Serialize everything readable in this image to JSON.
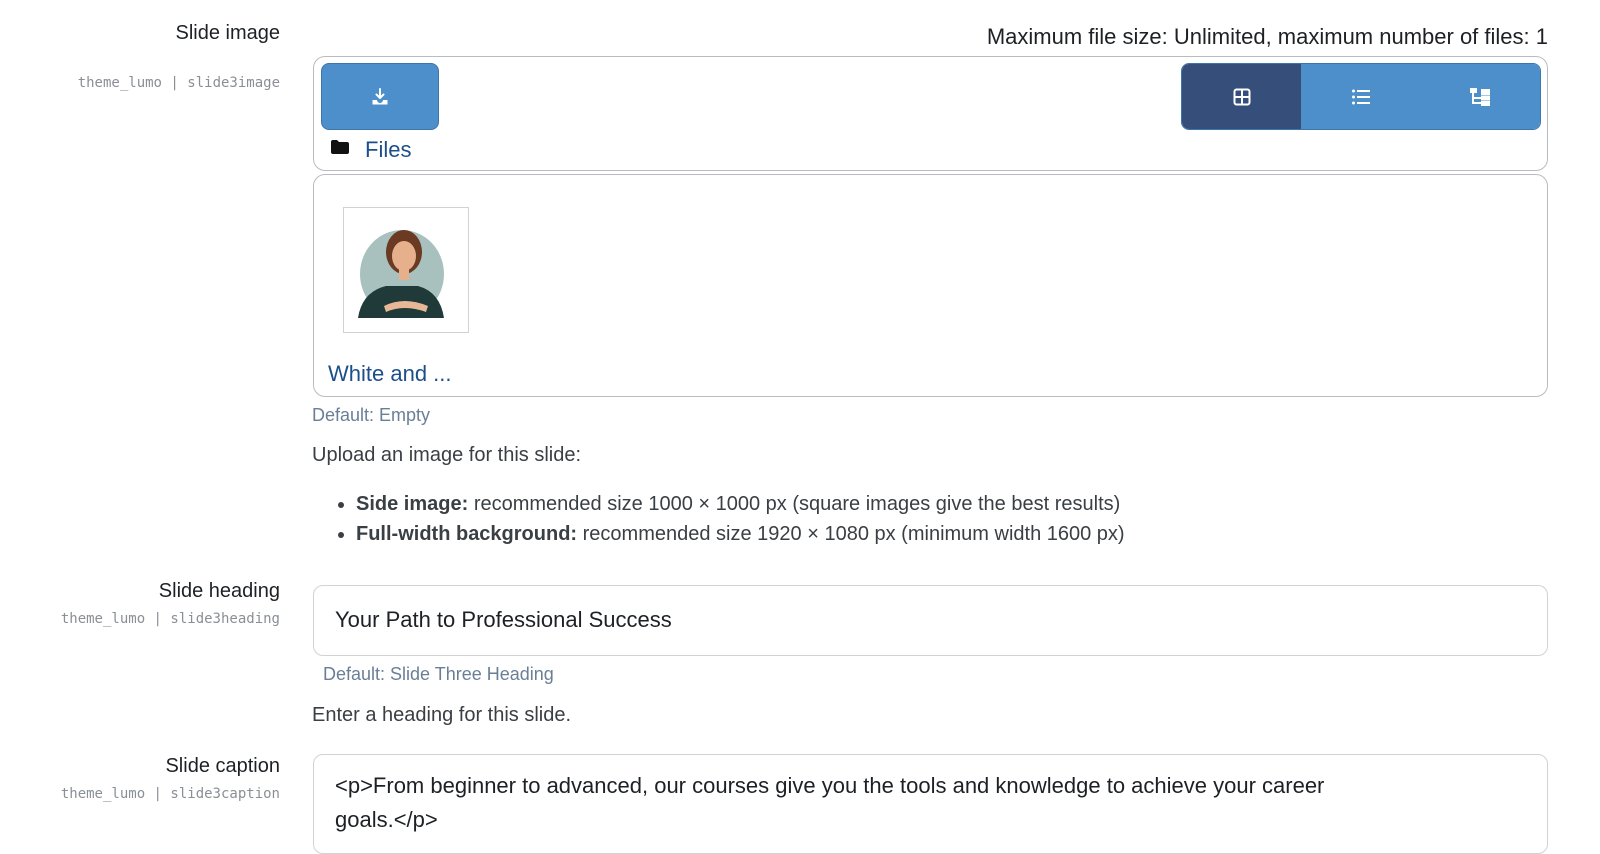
{
  "slide_image": {
    "label": "Slide image",
    "setting": "theme_lumo | slide3image",
    "max_info": "Maximum file size: Unlimited, maximum number of files: 1",
    "upload_icon": "download-tray-icon",
    "view_buttons": [
      {
        "icon": "grid-view-icon",
        "active": true
      },
      {
        "icon": "list-view-icon",
        "active": false
      },
      {
        "icon": "tree-view-icon",
        "active": false
      }
    ],
    "folder_icon": "folder-icon",
    "folder_label": "Files",
    "file": {
      "name": "White and ..."
    },
    "default": "Default: Empty",
    "description": "Upload an image for this slide:",
    "bullets": [
      {
        "strong": "Side image:",
        "text": " recommended size 1000 × 1000 px (square images give the best results)"
      },
      {
        "strong": "Full-width background:",
        "text": " recommended size 1920 × 1080 px (minimum width 1600 px)"
      }
    ]
  },
  "slide_heading": {
    "label": "Slide heading",
    "setting": "theme_lumo | slide3heading",
    "value": "Your Path to Professional Success",
    "default": "Default: Slide Three Heading",
    "description": "Enter a heading for this slide."
  },
  "slide_caption": {
    "label": "Slide caption",
    "setting": "theme_lumo | slide3caption",
    "value_line1": "<p>From beginner to advanced, our courses give you the tools and knowledge to achieve your career",
    "value_line2": "goals.</p>"
  },
  "colors": {
    "primary": "#4d8fcb",
    "active_view": "#364f7a",
    "link": "#1c4f8a",
    "muted": "#6a7f96"
  }
}
